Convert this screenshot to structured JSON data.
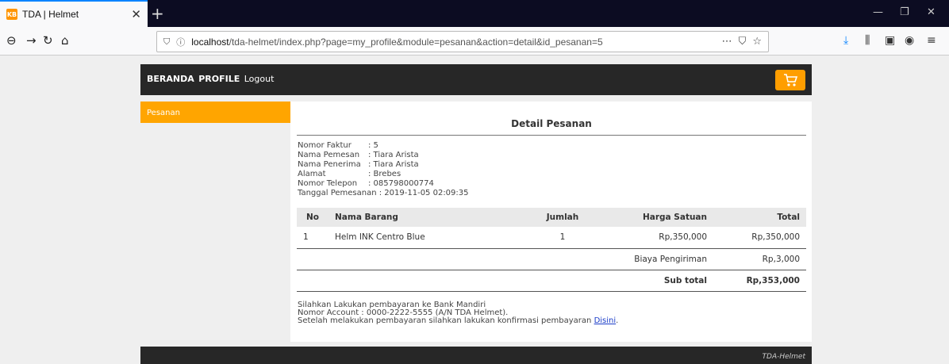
{
  "browser": {
    "tab_title": "TDA | Helmet",
    "favicon_label": "KB",
    "url_host": "localhost",
    "url_path": "/tda-helmet/index.php?page=my_profile&module=pesanan&action=detail&id_pesanan=5"
  },
  "nav": {
    "beranda": "BERANDA",
    "profile": "PROFILE",
    "logout": "Logout"
  },
  "sidebar": {
    "items": [
      {
        "label": "Pesanan"
      }
    ]
  },
  "detail": {
    "title": "Detail Pesanan",
    "info": [
      {
        "label": "Nomor Faktur",
        "value": ": 5"
      },
      {
        "label": "Nama Pemesan",
        "value": ": Tiara Arista"
      },
      {
        "label": "Nama Penerima",
        "value": ": Tiara Arista"
      },
      {
        "label": "Alamat",
        "value": ": Brebes"
      },
      {
        "label": "Nomor Telepon",
        "value": ": 085798000774"
      },
      {
        "label": "Tanggal Pemesanan",
        "value": ": 2019-11-05 02:09:35"
      }
    ],
    "table": {
      "headers": {
        "no": "No",
        "nama": "Nama Barang",
        "jumlah": "Jumlah",
        "harga": "Harga Satuan",
        "total": "Total"
      },
      "rows": [
        {
          "no": "1",
          "nama": "Helm INK Centro Blue",
          "jumlah": "1",
          "harga": "Rp,350,000",
          "total": "Rp,350,000"
        }
      ],
      "shipping_label": "Biaya Pengiriman",
      "shipping_value": "Rp,3,000",
      "subtotal_label": "Sub total",
      "subtotal_value": "Rp,353,000"
    },
    "payment": {
      "line1": "Silahkan Lakukan pembayaran ke Bank Mandiri",
      "line2": "Nomor Account : 0000-2222-5555 (A/N TDA Helmet).",
      "line3": "Setelah melakukan pembayaran silahkan lakukan konfirmasi pembayaran",
      "link": "Disini",
      "suffix": "."
    }
  },
  "footer": {
    "text": "TDA-Helmet"
  },
  "colors": {
    "accent": "#ffa500",
    "dark": "#272727"
  }
}
